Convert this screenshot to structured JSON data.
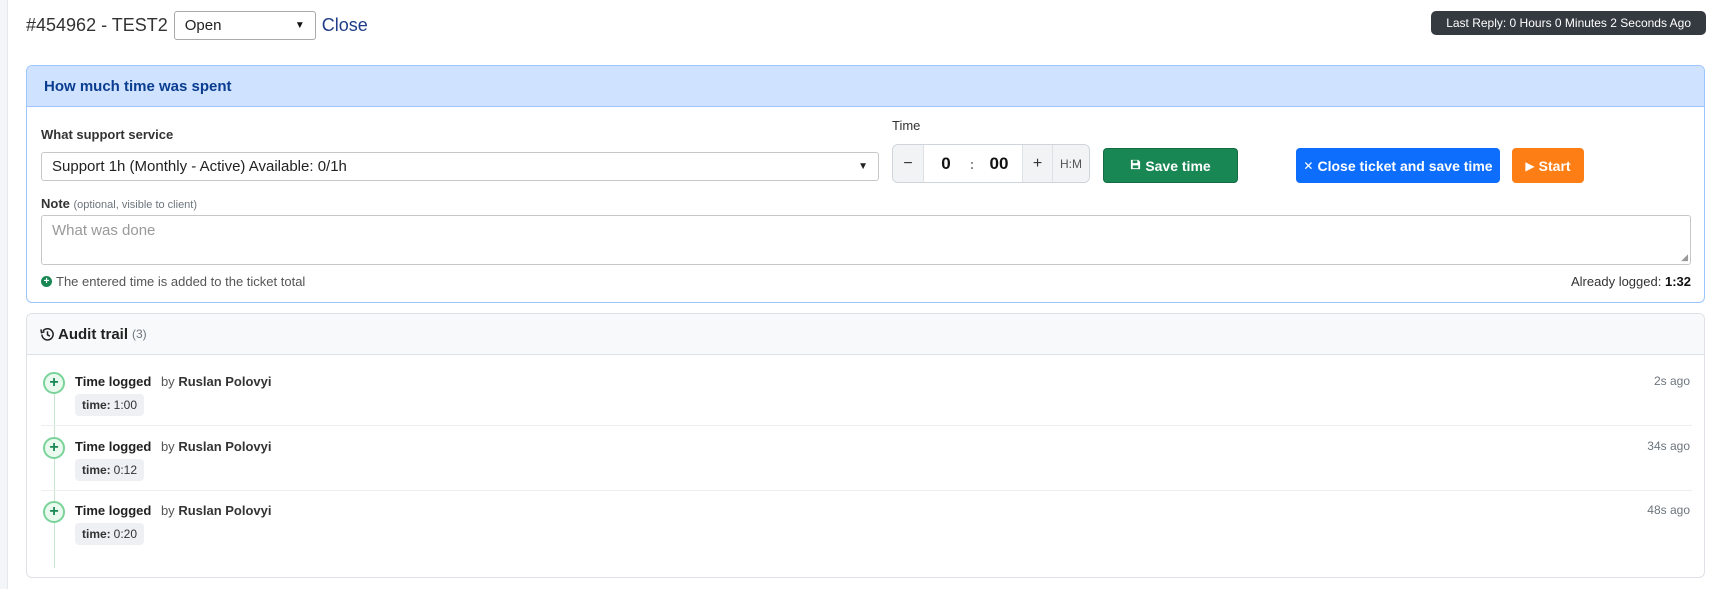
{
  "header": {
    "ticket_title": "#454962 - TEST2",
    "status_value": "Open",
    "close_link": "Close",
    "last_reply": "Last Reply: 0 Hours 0 Minutes 2 Seconds Ago"
  },
  "time_card": {
    "title": "How much time was spent",
    "service_label": "What support service",
    "service_value": "Support 1h (Monthly - Active) Available: 0/1h",
    "time_label": "Time",
    "hours": "0",
    "minutes": "00",
    "minus": "−",
    "plus": "+",
    "separator": ":",
    "unit": "H:M",
    "save_label": "Save time",
    "close_save_label": "Close ticket and save time",
    "start_label": "Start",
    "note_label": "Note",
    "note_hint": "(optional, visible to client)",
    "note_placeholder": "What was done",
    "info_text": "The entered time is added to the ticket total",
    "logged_label": "Already logged:",
    "logged_value": "1:32"
  },
  "audit": {
    "title": "Audit trail",
    "count": "(3)",
    "items": [
      {
        "event": "Time logged",
        "by": "by",
        "user": "Ruslan Polovyi",
        "key": "time:",
        "value": "1:00",
        "ago": "2s ago"
      },
      {
        "event": "Time logged",
        "by": "by",
        "user": "Ruslan Polovyi",
        "key": "time:",
        "value": "0:12",
        "ago": "34s ago"
      },
      {
        "event": "Time logged",
        "by": "by",
        "user": "Ruslan Polovyi",
        "key": "time:",
        "value": "0:20",
        "ago": "48s ago"
      }
    ]
  },
  "colors": {
    "primary": "#0d6efd",
    "success": "#198754",
    "warning": "#fd7e14",
    "info_header": "#cfe2ff",
    "dark_badge": "#343a40"
  }
}
